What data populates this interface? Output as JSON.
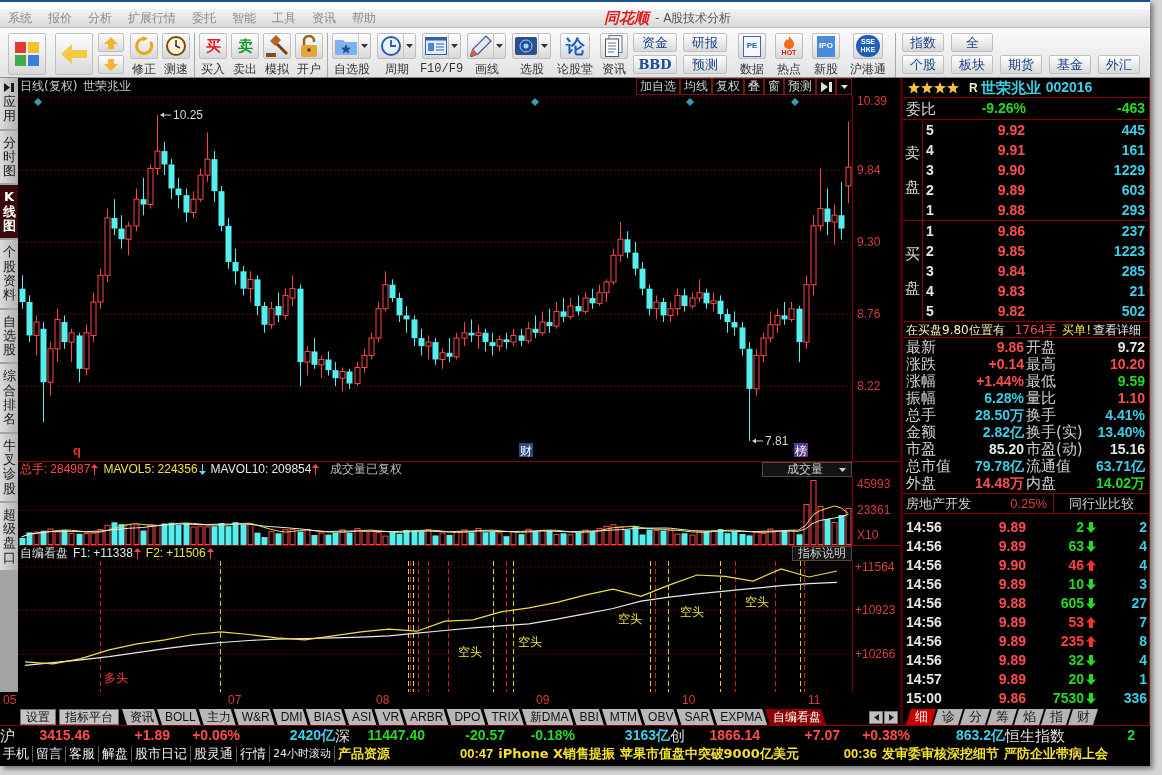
{
  "menu_bar": {
    "items": [
      "系统",
      "报价",
      "分析",
      "扩展行情",
      "委托",
      "智能",
      "工具",
      "资讯",
      "帮助"
    ],
    "logo": "同花顺",
    "title": "- A股技术分析"
  },
  "toolbar": {
    "tools": [
      {
        "label": "修正"
      },
      {
        "label": "测速"
      }
    ],
    "trade": [
      {
        "label": "买入",
        "glyph": "买"
      },
      {
        "label": "卖出",
        "glyph": "卖"
      },
      {
        "label": "模拟"
      },
      {
        "label": "开户"
      }
    ],
    "menus": [
      {
        "label": "自选股"
      },
      {
        "label": "周期"
      },
      {
        "label": "F10/F9"
      },
      {
        "label": "画线"
      },
      {
        "label": "选股"
      }
    ],
    "info": [
      {
        "label": "论股堂",
        "glyph": "论"
      },
      {
        "label": "资讯"
      }
    ],
    "pairs": [
      [
        "资金",
        "BBD"
      ],
      [
        "研报",
        "预测"
      ]
    ],
    "apps": [
      {
        "label": "数据",
        "glyph": "PE"
      },
      {
        "label": "热点",
        "glyph": "HOT"
      },
      {
        "label": "新股",
        "glyph": "IPO"
      },
      {
        "label": "沪港通",
        "glyph": "SSE HKE"
      }
    ],
    "markets": [
      [
        "指数",
        "全"
      ],
      [
        "个股",
        "板块",
        "期货",
        "基金",
        "外汇"
      ]
    ]
  },
  "left_tabs": [
    {
      "label": "应用",
      "selected": false
    },
    {
      "label": "分时图",
      "selected": false
    },
    {
      "label": "K线图",
      "selected": true
    },
    {
      "label": "个股资料",
      "selected": false
    },
    {
      "label": "自选股",
      "selected": false
    },
    {
      "label": "综合排名",
      "selected": false
    },
    {
      "label": "牛叉诊股",
      "selected": false
    },
    {
      "label": "超级盘口",
      "selected": false
    }
  ],
  "chart": {
    "period": "日线(复权)",
    "stock": "世荣兆业",
    "buttons": [
      "加自选",
      "均线",
      "复权",
      "叠",
      "窗",
      "预测"
    ],
    "high_label": "10.25",
    "low_label": "7.81",
    "event_marks": [
      {
        "text": "q",
        "kind": "letter"
      },
      {
        "text": "财",
        "kind": "finance"
      },
      {
        "text": "榜",
        "kind": "ranking"
      }
    ],
    "chart_data": {
      "type": "candlestick",
      "grid": true,
      "ylim": [
        7.66,
        10.4
      ],
      "yticks": [
        {
          "value": 10.39,
          "label": "10.39"
        },
        {
          "value": 9.84,
          "label": "9.84"
        },
        {
          "value": 9.3,
          "label": "9.30"
        },
        {
          "value": 8.76,
          "label": "8.76"
        },
        {
          "value": 8.22,
          "label": "8.22"
        }
      ],
      "categories": [
        null,
        null,
        null,
        null,
        null,
        null,
        null,
        null,
        null,
        null,
        null,
        null,
        null,
        null,
        null,
        null,
        null,
        null,
        null,
        null,
        null,
        null,
        null,
        null,
        null,
        null,
        null,
        null,
        null,
        null,
        null,
        null,
        null,
        null,
        null,
        null,
        null,
        null,
        null,
        null,
        null,
        null,
        null,
        null,
        null,
        null,
        null,
        null,
        null,
        null,
        null,
        null,
        null,
        null,
        null,
        null,
        null,
        null,
        null,
        null,
        null,
        null,
        null,
        null,
        null,
        null,
        null,
        null,
        null,
        null,
        null,
        null,
        null,
        null,
        null,
        null,
        null,
        null,
        null,
        null,
        null,
        null,
        null,
        null,
        null,
        null,
        null,
        null,
        null,
        null,
        null,
        null,
        null,
        null,
        null,
        null,
        null,
        null,
        null,
        null,
        null,
        null,
        null,
        null,
        null,
        null,
        null,
        null,
        null,
        null,
        null,
        null,
        null,
        null,
        null,
        null,
        null
      ],
      "ohlc": [
        [
          8.95,
          9.05,
          8.8,
          8.85
        ],
        [
          8.85,
          8.9,
          8.55,
          8.6
        ],
        [
          8.6,
          8.75,
          8.45,
          8.7
        ],
        [
          8.65,
          8.7,
          7.95,
          8.25
        ],
        [
          8.25,
          8.55,
          8.15,
          8.5
        ],
        [
          8.5,
          8.8,
          8.4,
          8.72
        ],
        [
          8.7,
          8.75,
          8.5,
          8.55
        ],
        [
          8.55,
          8.65,
          8.4,
          8.62
        ],
        [
          8.6,
          8.62,
          8.25,
          8.35
        ],
        [
          8.35,
          8.68,
          8.3,
          8.62
        ],
        [
          8.6,
          8.92,
          8.55,
          8.85
        ],
        [
          8.85,
          9.1,
          8.8,
          9.05
        ],
        [
          9.05,
          9.55,
          9.0,
          9.48
        ],
        [
          9.48,
          9.62,
          9.35,
          9.4
        ],
        [
          9.4,
          9.5,
          9.25,
          9.32
        ],
        [
          9.32,
          9.45,
          9.2,
          9.42
        ],
        [
          9.42,
          9.7,
          9.38,
          9.62
        ],
        [
          9.62,
          9.78,
          9.5,
          9.58
        ],
        [
          9.58,
          9.88,
          9.55,
          9.85
        ],
        [
          9.85,
          10.25,
          9.8,
          9.98
        ],
        [
          9.98,
          10.05,
          9.8,
          9.88
        ],
        [
          9.88,
          9.92,
          9.62,
          9.7
        ],
        [
          9.7,
          9.78,
          9.55,
          9.65
        ],
        [
          9.65,
          9.7,
          9.45,
          9.52
        ],
        [
          9.52,
          9.68,
          9.48,
          9.62
        ],
        [
          9.62,
          9.85,
          9.6,
          9.8
        ],
        [
          9.8,
          10.12,
          9.75,
          9.92
        ],
        [
          9.92,
          9.98,
          9.6,
          9.68
        ],
        [
          9.68,
          9.72,
          9.38,
          9.42
        ],
        [
          9.42,
          9.48,
          9.1,
          9.15
        ],
        [
          9.15,
          9.25,
          8.98,
          9.08
        ],
        [
          9.08,
          9.12,
          8.9,
          8.95
        ],
        [
          8.95,
          9.08,
          8.85,
          9.02
        ],
        [
          9.02,
          9.05,
          8.75,
          8.82
        ],
        [
          8.82,
          8.85,
          8.62,
          8.68
        ],
        [
          8.68,
          8.85,
          8.65,
          8.8
        ],
        [
          8.82,
          8.92,
          8.7,
          8.75
        ],
        [
          8.75,
          8.95,
          8.72,
          8.9
        ],
        [
          8.88,
          9.05,
          8.82,
          8.95
        ],
        [
          8.95,
          8.98,
          8.22,
          8.4
        ],
        [
          8.4,
          8.52,
          8.3,
          8.48
        ],
        [
          8.48,
          8.58,
          8.35,
          8.38
        ],
        [
          8.38,
          8.45,
          8.28,
          8.42
        ],
        [
          8.42,
          8.48,
          8.3,
          8.34
        ],
        [
          8.34,
          8.4,
          8.22,
          8.28
        ],
        [
          8.28,
          8.36,
          8.18,
          8.33
        ],
        [
          8.33,
          8.35,
          8.2,
          8.24
        ],
        [
          8.24,
          8.4,
          8.22,
          8.36
        ],
        [
          8.36,
          8.5,
          8.32,
          8.45
        ],
        [
          8.45,
          8.62,
          8.42,
          8.58
        ],
        [
          8.58,
          8.85,
          8.55,
          8.8
        ],
        [
          8.8,
          9.08,
          8.78,
          8.98
        ],
        [
          8.98,
          9.02,
          8.85,
          8.88
        ],
        [
          8.88,
          8.92,
          8.7,
          8.75
        ],
        [
          8.75,
          8.82,
          8.62,
          8.72
        ],
        [
          8.72,
          8.75,
          8.52,
          8.58
        ],
        [
          8.58,
          8.65,
          8.45,
          8.52
        ],
        [
          8.52,
          8.6,
          8.42,
          8.55
        ],
        [
          8.55,
          8.58,
          8.38,
          8.42
        ],
        [
          8.42,
          8.5,
          8.35,
          8.47
        ],
        [
          8.47,
          8.58,
          8.4,
          8.44
        ],
        [
          8.44,
          8.62,
          8.42,
          8.58
        ],
        [
          8.58,
          8.7,
          8.52,
          8.62
        ],
        [
          8.62,
          8.72,
          8.55,
          8.6
        ],
        [
          8.6,
          8.68,
          8.5,
          8.62
        ],
        [
          8.62,
          8.65,
          8.48,
          8.55
        ],
        [
          8.55,
          8.62,
          8.45,
          8.52
        ],
        [
          8.52,
          8.6,
          8.48,
          8.57
        ],
        [
          8.57,
          8.62,
          8.5,
          8.55
        ],
        [
          8.55,
          8.65,
          8.52,
          8.6
        ],
        [
          8.6,
          8.65,
          8.52,
          8.56
        ],
        [
          8.56,
          8.7,
          8.54,
          8.65
        ],
        [
          8.65,
          8.75,
          8.58,
          8.62
        ],
        [
          8.62,
          8.78,
          8.6,
          8.7
        ],
        [
          8.7,
          8.8,
          8.62,
          8.67
        ],
        [
          8.67,
          8.85,
          8.65,
          8.78
        ],
        [
          8.78,
          8.88,
          8.7,
          8.74
        ],
        [
          8.74,
          8.88,
          8.72,
          8.82
        ],
        [
          8.82,
          8.9,
          8.75,
          8.78
        ],
        [
          8.78,
          8.92,
          8.76,
          8.88
        ],
        [
          8.88,
          8.95,
          8.8,
          8.84
        ],
        [
          8.84,
          8.98,
          8.82,
          8.92
        ],
        [
          8.92,
          9.02,
          8.85,
          9.0
        ],
        [
          9.0,
          9.25,
          8.98,
          9.2
        ],
        [
          9.2,
          9.45,
          9.15,
          9.32
        ],
        [
          9.32,
          9.38,
          9.18,
          9.22
        ],
        [
          9.22,
          9.3,
          9.05,
          9.1
        ],
        [
          9.1,
          9.15,
          8.9,
          8.95
        ],
        [
          8.95,
          8.98,
          8.75,
          8.8
        ],
        [
          8.8,
          8.9,
          8.72,
          8.85
        ],
        [
          8.85,
          8.88,
          8.7,
          8.75
        ],
        [
          8.75,
          8.85,
          8.7,
          8.8
        ],
        [
          8.8,
          8.95,
          8.75,
          8.9
        ],
        [
          8.9,
          8.95,
          8.78,
          8.82
        ],
        [
          8.82,
          8.92,
          8.8,
          8.88
        ],
        [
          8.88,
          9.02,
          8.85,
          8.92
        ],
        [
          8.92,
          8.95,
          8.8,
          8.84
        ],
        [
          8.84,
          8.92,
          8.78,
          8.86
        ],
        [
          8.86,
          8.9,
          8.72,
          8.76
        ],
        [
          8.76,
          8.8,
          8.62,
          8.7
        ],
        [
          8.7,
          8.78,
          8.6,
          8.66
        ],
        [
          8.66,
          8.7,
          8.45,
          8.5
        ],
        [
          8.5,
          8.55,
          7.81,
          8.2
        ],
        [
          8.2,
          8.5,
          8.15,
          8.45
        ],
        [
          8.45,
          8.62,
          8.4,
          8.58
        ],
        [
          8.58,
          8.78,
          8.55,
          8.68
        ],
        [
          8.68,
          8.8,
          8.62,
          8.75
        ],
        [
          8.75,
          8.85,
          8.68,
          8.72
        ],
        [
          8.72,
          8.85,
          8.7,
          8.8
        ],
        [
          8.8,
          8.82,
          8.4,
          8.55
        ],
        [
          8.55,
          9.05,
          8.5,
          8.98
        ],
        [
          8.98,
          9.5,
          8.9,
          9.42
        ],
        [
          9.42,
          9.85,
          9.38,
          9.55
        ],
        [
          9.55,
          9.7,
          9.35,
          9.45
        ],
        [
          9.45,
          9.58,
          9.28,
          9.5
        ],
        [
          9.5,
          9.75,
          9.32,
          9.4
        ],
        [
          9.72,
          10.2,
          9.59,
          9.86
        ]
      ]
    }
  },
  "volume": {
    "series": [
      {
        "label": "总手:",
        "value": "284987",
        "rising": true,
        "color": "#ff4a4a"
      },
      {
        "label": "MAVOL5:",
        "value": "224356",
        "rising": false,
        "color": "#f0e040"
      },
      {
        "label": "MAVOL10:",
        "value": "209854",
        "rising": true,
        "color": "#e8e8e8"
      }
    ],
    "note": "成交量已复权",
    "selector": "成交量",
    "axis": [
      "45993",
      "23361",
      "X10"
    ]
  },
  "indicator": {
    "name": "自编看盘",
    "series": [
      {
        "label": "F1:",
        "value": "+11338",
        "rising": true,
        "color": "#e8e8e8"
      },
      {
        "label": "F2:",
        "value": "+11506",
        "rising": true,
        "color": "#f0e040"
      }
    ],
    "button": "指标说明",
    "chart_data": {
      "type": "line",
      "grid": true,
      "ylim": [
        9700,
        11660
      ],
      "yticks": [
        {
          "value": 11564,
          "label": "+11564"
        },
        {
          "value": 10923,
          "label": "+10923"
        },
        {
          "value": 10266,
          "label": "+10266"
        }
      ],
      "series": [
        {
          "color": "#e8e8e8",
          "values": [
            10100,
            10140,
            10180,
            10230,
            10290,
            10350,
            10400,
            10440,
            10470,
            10490,
            10500,
            10510,
            10520,
            10540,
            10580,
            10620,
            10660,
            10690,
            10720,
            10790,
            10870,
            10950,
            11060,
            11120,
            11170,
            11210,
            11250,
            11290,
            11320,
            11340
          ]
        },
        {
          "color": "#f0e040",
          "values": [
            10150,
            10120,
            10200,
            10330,
            10420,
            10480,
            10560,
            10600,
            10560,
            10510,
            10480,
            10540,
            10600,
            10640,
            10610,
            10760,
            10780,
            10900,
            10960,
            11040,
            11150,
            11240,
            11130,
            11300,
            11450,
            11430,
            11360,
            11540,
            11420,
            11510
          ]
        }
      ]
    },
    "signals": [
      {
        "text": "多头",
        "kind": "bull"
      },
      {
        "text": "空头",
        "kind": "bear"
      },
      {
        "text": "空头",
        "kind": "bear"
      },
      {
        "text": "空头",
        "kind": "bear"
      },
      {
        "text": "空头",
        "kind": "bear"
      },
      {
        "text": "空头",
        "kind": "bear"
      }
    ]
  },
  "x_axis": [
    "05",
    "07",
    "08",
    "09",
    "10",
    "11"
  ],
  "bottom_tabs": [
    {
      "label": "设置",
      "kind": "button",
      "selected": false
    },
    {
      "label": "指标平台",
      "kind": "button",
      "selected": false
    },
    {
      "label": "资讯",
      "kind": "tab",
      "selected": false
    },
    {
      "label": "BOLL",
      "kind": "tab",
      "selected": false
    },
    {
      "label": "主力",
      "kind": "tab",
      "selected": false
    },
    {
      "label": "W&R",
      "kind": "tab",
      "selected": false
    },
    {
      "label": "DMI",
      "kind": "tab",
      "selected": false
    },
    {
      "label": "BIAS",
      "kind": "tab",
      "selected": false
    },
    {
      "label": "ASI",
      "kind": "tab",
      "selected": false
    },
    {
      "label": "VR",
      "kind": "tab",
      "selected": false
    },
    {
      "label": "ARBR",
      "kind": "tab",
      "selected": false
    },
    {
      "label": "DPO",
      "kind": "tab",
      "selected": false
    },
    {
      "label": "TRIX",
      "kind": "tab",
      "selected": false
    },
    {
      "label": "新DMA",
      "kind": "tab",
      "selected": false
    },
    {
      "label": "BBI",
      "kind": "tab",
      "selected": false
    },
    {
      "label": "MTM",
      "kind": "tab",
      "selected": false
    },
    {
      "label": "OBV",
      "kind": "tab",
      "selected": false
    },
    {
      "label": "SAR",
      "kind": "tab",
      "selected": false
    },
    {
      "label": "EXPMA",
      "kind": "tab",
      "selected": false
    },
    {
      "label": "自编看盘",
      "kind": "tab",
      "selected": true
    }
  ],
  "quote": {
    "stars": 4,
    "badge": "R",
    "name": "世荣兆业",
    "code": "002016",
    "order_ratio": {
      "label": "委比",
      "percent": "-9.26%",
      "diff": "-463",
      "color": "#26d926"
    },
    "ask": {
      "label": "卖盘",
      "rows": [
        {
          "rank": "5",
          "price": "9.92",
          "volume": "445"
        },
        {
          "rank": "4",
          "price": "9.91",
          "volume": "161"
        },
        {
          "rank": "3",
          "price": "9.90",
          "volume": "1229"
        },
        {
          "rank": "2",
          "price": "9.89",
          "volume": "603"
        },
        {
          "rank": "1",
          "price": "9.88",
          "volume": "293"
        }
      ]
    },
    "bid": {
      "label": "买盘",
      "rows": [
        {
          "rank": "1",
          "price": "9.86",
          "volume": "237"
        },
        {
          "rank": "2",
          "price": "9.85",
          "volume": "1223"
        },
        {
          "rank": "3",
          "price": "9.84",
          "volume": "285"
        },
        {
          "rank": "4",
          "price": "9.83",
          "volume": "21"
        },
        {
          "rank": "5",
          "price": "9.82",
          "volume": "502"
        }
      ]
    },
    "notice": {
      "prefix": "在买盘9.80位置有",
      "amount": "1764手",
      "suffix": "买单!",
      "link": "查看详细"
    },
    "stats": [
      {
        "left": {
          "label": "最新",
          "value": "9.86",
          "color": "#ff4d4d"
        },
        "right": {
          "label": "开盘",
          "value": "9.72",
          "color": "#e8e8e8"
        }
      },
      {
        "left": {
          "label": "涨跌",
          "value": "+0.14",
          "color": "#ff4d4d"
        },
        "right": {
          "label": "最高",
          "value": "10.20",
          "color": "#ff4d4d"
        }
      },
      {
        "left": {
          "label": "涨幅",
          "value": "+1.44%",
          "color": "#ff4d4d"
        },
        "right": {
          "label": "最低",
          "value": "9.59",
          "color": "#26d926"
        }
      },
      {
        "left": {
          "label": "振幅",
          "value": "6.28%",
          "color": "#3ccfe6"
        },
        "right": {
          "label": "量比",
          "value": "1.10",
          "color": "#ff4d4d"
        }
      },
      {
        "left": {
          "label": "总手",
          "value": "28.50万",
          "color": "#3ccfe6"
        },
        "right": {
          "label": "换手",
          "value": "4.41%",
          "color": "#3ccfe6"
        }
      },
      {
        "left": {
          "label": "金额",
          "value": "2.82亿",
          "color": "#3ccfe6"
        },
        "right": {
          "label": "换手(实)",
          "value": "13.40%",
          "color": "#3ccfe6"
        }
      },
      {
        "left": {
          "label": "市盈",
          "value": "85.20",
          "color": "#e8e8e8"
        },
        "right": {
          "label": "市盈(动)",
          "value": "15.16",
          "color": "#e8e8e8"
        }
      },
      {
        "left": {
          "label": "总市值",
          "value": "79.78亿",
          "color": "#3ccfe6"
        },
        "right": {
          "label": "流通值",
          "value": "63.71亿",
          "color": "#3ccfe6"
        }
      },
      {
        "left": {
          "label": "外盘",
          "value": "14.48万",
          "color": "#ff4d4d"
        },
        "right": {
          "label": "内盘",
          "value": "14.02万",
          "color": "#26d926"
        }
      }
    ],
    "industry": {
      "name": "房地产开发",
      "change": "0.25%",
      "button": "同行业比较"
    },
    "ticks": [
      {
        "time": "14:56",
        "price": "9.89",
        "volume": "2",
        "rising": false,
        "count": "2"
      },
      {
        "time": "14:56",
        "price": "9.89",
        "volume": "63",
        "rising": false,
        "count": "4"
      },
      {
        "time": "14:56",
        "price": "9.90",
        "volume": "46",
        "rising": true,
        "count": "4"
      },
      {
        "time": "14:56",
        "price": "9.89",
        "volume": "10",
        "rising": false,
        "count": "3"
      },
      {
        "time": "14:56",
        "price": "9.88",
        "volume": "605",
        "rising": false,
        "count": "27"
      },
      {
        "time": "14:56",
        "price": "9.89",
        "volume": "53",
        "rising": true,
        "count": "7"
      },
      {
        "time": "14:56",
        "price": "9.89",
        "volume": "235",
        "rising": true,
        "count": "8"
      },
      {
        "time": "14:56",
        "price": "9.89",
        "volume": "32",
        "rising": false,
        "count": "4"
      },
      {
        "time": "14:57",
        "price": "9.89",
        "volume": "20",
        "rising": false,
        "count": "1"
      },
      {
        "time": "15:00",
        "price": "9.86",
        "volume": "7530",
        "rising": false,
        "count": "336"
      }
    ],
    "tabs": [
      {
        "label": "细",
        "selected": true
      },
      {
        "label": "诊",
        "selected": false
      },
      {
        "label": "分",
        "selected": false
      },
      {
        "label": "筹",
        "selected": false
      },
      {
        "label": "焰",
        "selected": false
      },
      {
        "label": "指",
        "selected": false
      },
      {
        "label": "财",
        "selected": false
      }
    ]
  },
  "index_bar": [
    {
      "name": "沪",
      "value": "3415.46",
      "change": "+1.89",
      "percent": "+0.06%",
      "turnover": "2420亿",
      "color": "#ff4d4d"
    },
    {
      "name": "深",
      "value": "11447.40",
      "change": "-20.57",
      "percent": "-0.18%",
      "turnover": "3163亿",
      "color": "#26d926"
    },
    {
      "name": "创",
      "value": "1866.14",
      "change": "+7.07",
      "percent": "+0.38%",
      "turnover": "863.2亿",
      "color": "#ff4d4d"
    },
    {
      "name": "恒生指数",
      "value": "2",
      "color": "#26d926"
    }
  ],
  "news_bar": {
    "links": [
      "手机",
      "留言",
      "客服",
      "解盘",
      "股市日记",
      "股灵通",
      "行情"
    ],
    "mode": "24小时滚动",
    "channel": "产品资源",
    "headlines": [
      {
        "time": "00:47",
        "text": "iPhone X销售提振 苹果市值盘中突破9000亿美元"
      },
      {
        "time": "00:36",
        "text": "发审委审核深挖细节 严防企业带病上会"
      }
    ]
  }
}
